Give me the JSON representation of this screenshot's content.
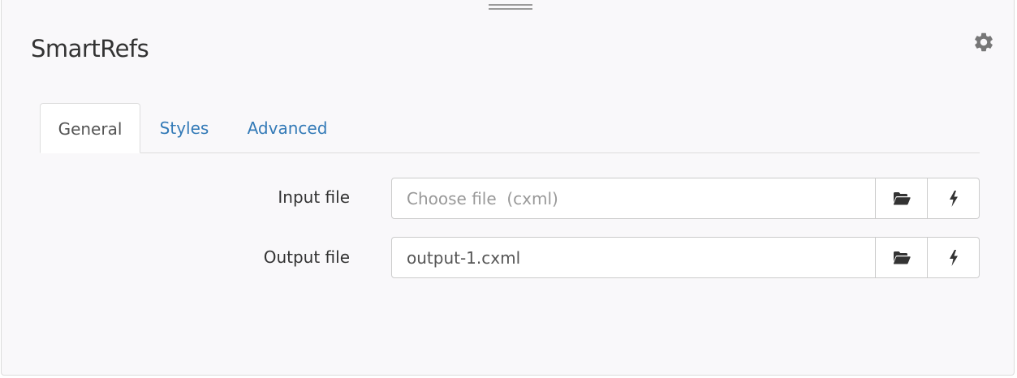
{
  "app": {
    "title": "SmartRefs"
  },
  "icons": {
    "settings": "gear-icon",
    "drag": "drag-handle-icon",
    "browse": "folder-open-icon",
    "action": "lightning-bolt-icon"
  },
  "tabs": [
    {
      "label": "General",
      "active": true
    },
    {
      "label": "Styles",
      "active": false
    },
    {
      "label": "Advanced",
      "active": false
    }
  ],
  "form": {
    "input_file": {
      "label": "Input file",
      "value": "",
      "placeholder": "Choose file  (cxml)"
    },
    "output_file": {
      "label": "Output file",
      "value": "output-1.cxml",
      "placeholder": ""
    }
  },
  "colors": {
    "link": "#337ab7",
    "panel_bg": "#f9f8fa",
    "border": "#cccccc",
    "text": "#333333",
    "icon": "#777777"
  }
}
